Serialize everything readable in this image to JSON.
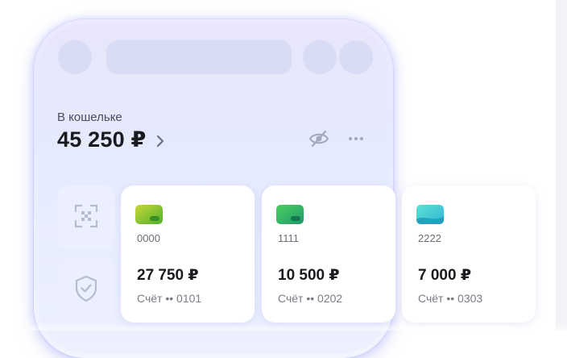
{
  "wallet": {
    "label": "В кошельке",
    "balance": "45 250 ₽"
  },
  "icons": {
    "open_wallet": "chevron-right-icon",
    "hide_balance": "eye-slash-icon",
    "more": "more-dots-icon",
    "qr_scan": "qr-scan-icon",
    "security": "shield-check-icon"
  },
  "cards": [
    {
      "number": "0000",
      "balance": "27 750 ₽",
      "account": "Счёт •• 0101",
      "colors": [
        "#c8d83a",
        "#4fb02a"
      ]
    },
    {
      "number": "1111",
      "balance": "10 500 ₽",
      "account": "Счёт •• 0202",
      "colors": [
        "#4ccf60",
        "#1e9a6a"
      ]
    },
    {
      "number": "2222",
      "balance": "7 000 ₽",
      "account": "Счёт •• 0303",
      "colors": [
        "#5fe0d2",
        "#2fb7d8"
      ]
    }
  ],
  "theme": {
    "accent": "#e3e8ff",
    "phone_frame_glow": "#a9b0f5",
    "icon_gray": "#9aa0b4"
  }
}
